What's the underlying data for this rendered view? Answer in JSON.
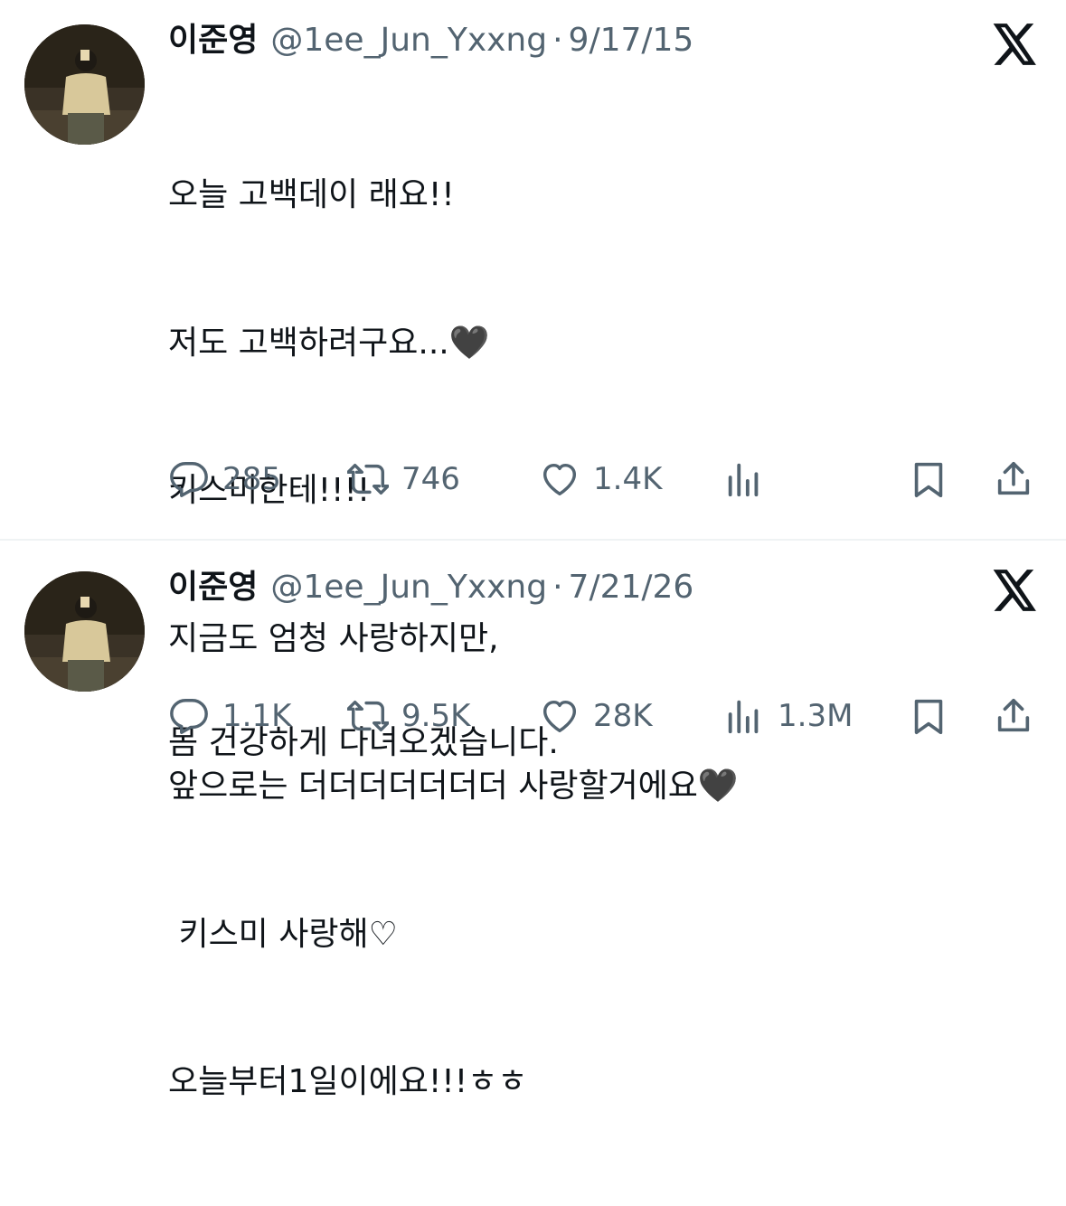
{
  "tweets": [
    {
      "author": {
        "name": "이준영",
        "handle": "@1ee_Jun_Yxxng"
      },
      "separator": "·",
      "date": "9/17/15",
      "lines": [
        "오늘 고백데이 래요!!",
        "저도 고백하려구요...🖤",
        "키스미한테!!!!",
        "지금도 엄청 사랑하지만,",
        "앞으로는 더더더더더더더 사랑할거에요🖤",
        " 키스미 사랑해♡",
        "오늘부터1일이에요!!!ㅎㅎ"
      ],
      "stats": {
        "replies": "285",
        "reposts": "746",
        "likes": "1.4K",
        "views": ""
      }
    },
    {
      "author": {
        "name": "이준영",
        "handle": "@1ee_Jun_Yxxng"
      },
      "separator": "·",
      "date": "7/21/26",
      "lines": [
        "몸 건강하게 다녀오겠습니다."
      ],
      "stats": {
        "replies": "1.1K",
        "reposts": "9.5K",
        "likes": "28K",
        "views": "1.3M"
      }
    }
  ],
  "icons": {
    "reply": "speech-bubble-icon",
    "repost": "repost-arrows-icon",
    "like": "heart-icon",
    "views": "bar-chart-icon",
    "bookmark": "bookmark-icon",
    "share": "share-upload-icon",
    "brand": "x-logo-icon"
  },
  "colors": {
    "text": "#0f1419",
    "secondary": "#536471",
    "divider": "#eff3f4"
  }
}
